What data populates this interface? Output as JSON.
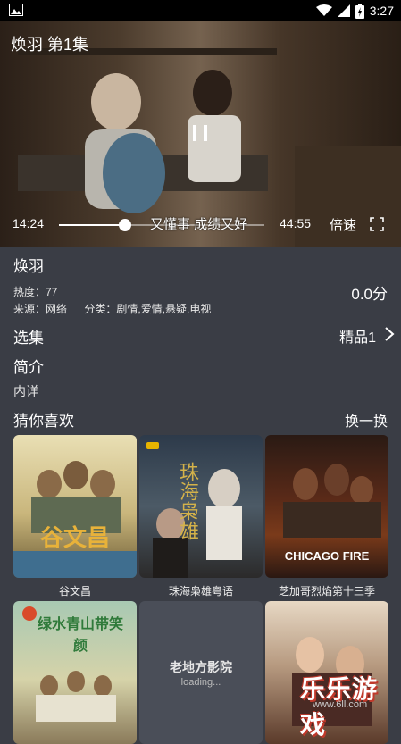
{
  "status": {
    "time": "3:27",
    "battery": "battery"
  },
  "player": {
    "title": "焕羽 第1集",
    "current_time": "14:24",
    "total_time": "44:55",
    "progress": 0.32,
    "subtitle": "又懂事 成绩又好",
    "speed_label": "倍速"
  },
  "info": {
    "title": "焕羽",
    "heat": "热度：77",
    "source": "来源：网络",
    "category": "分类：剧情,爱情,悬疑,电视",
    "score": "0.0分"
  },
  "episodes": {
    "label": "选集",
    "value": "精品1"
  },
  "intro": {
    "label": "简介",
    "detail": "内详"
  },
  "recommend": {
    "label": "猜你喜欢",
    "refresh": "换一换",
    "items": [
      {
        "title": "谷文昌",
        "poster_text": "谷文昌"
      },
      {
        "title": "珠海枭雄粤语",
        "poster_text": "珠海枭雄"
      },
      {
        "title": "芝加哥烈焰第十三季",
        "poster_text": "CHICAGO FIRE"
      },
      {
        "title": "",
        "poster_text": "绿水青山带笑颜"
      },
      {
        "title": "",
        "poster_text": "老地方影院",
        "poster_sub": "loading..."
      },
      {
        "title": "",
        "poster_text": ""
      }
    ]
  },
  "watermark": {
    "text": "乐乐游戏",
    "url": "www.6ll.com"
  }
}
